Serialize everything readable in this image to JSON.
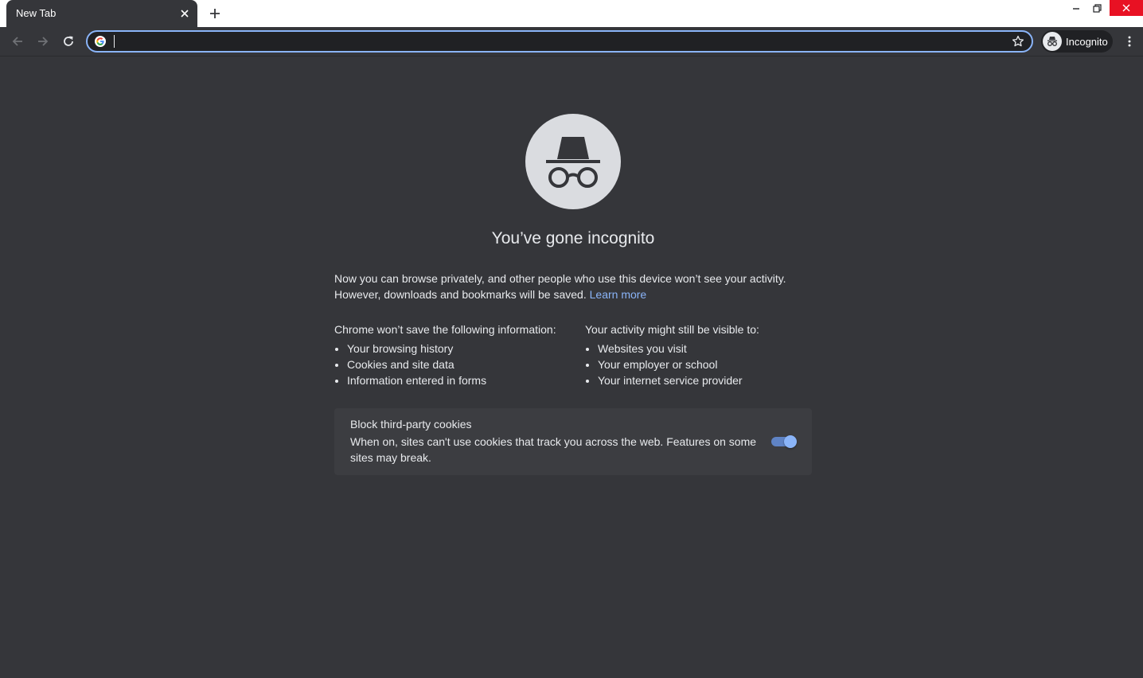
{
  "window": {
    "tab_title": "New Tab",
    "icons": {
      "tab_close": "close-icon",
      "new_tab": "plus-icon",
      "minimize": "minimize-icon",
      "restore": "restore-icon",
      "close": "close-icon"
    }
  },
  "toolbar": {
    "omnibox_value": "",
    "profile_label": "Incognito",
    "icons": {
      "back": "arrow-left-icon",
      "forward": "arrow-right-icon",
      "reload": "reload-icon",
      "search_engine": "google-icon",
      "bookmark": "star-icon",
      "menu": "more-vert-icon"
    }
  },
  "page": {
    "heading": "You’ve gone incognito",
    "intro_text": "Now you can browse privately, and other people who use this device won’t see your activity. However, downloads and bookmarks will be saved.",
    "learn_more": "Learn more",
    "not_saved": {
      "title": "Chrome won’t save the following information:",
      "items": [
        "Your browsing history",
        "Cookies and site data",
        "Information entered in forms"
      ]
    },
    "still_visible": {
      "title": "Your activity might still be visible to:",
      "items": [
        "Websites you visit",
        "Your employer or school",
        "Your internet service provider"
      ]
    },
    "cookies": {
      "title": "Block third-party cookies",
      "description": "When on, sites can't use cookies that track you across the web. Features on some sites may break.",
      "enabled": true
    }
  },
  "colors": {
    "page_background": "#35363a",
    "link": "#8ab4f8",
    "toggle_on": "#8ab4f8",
    "window_close": "#e81123"
  }
}
